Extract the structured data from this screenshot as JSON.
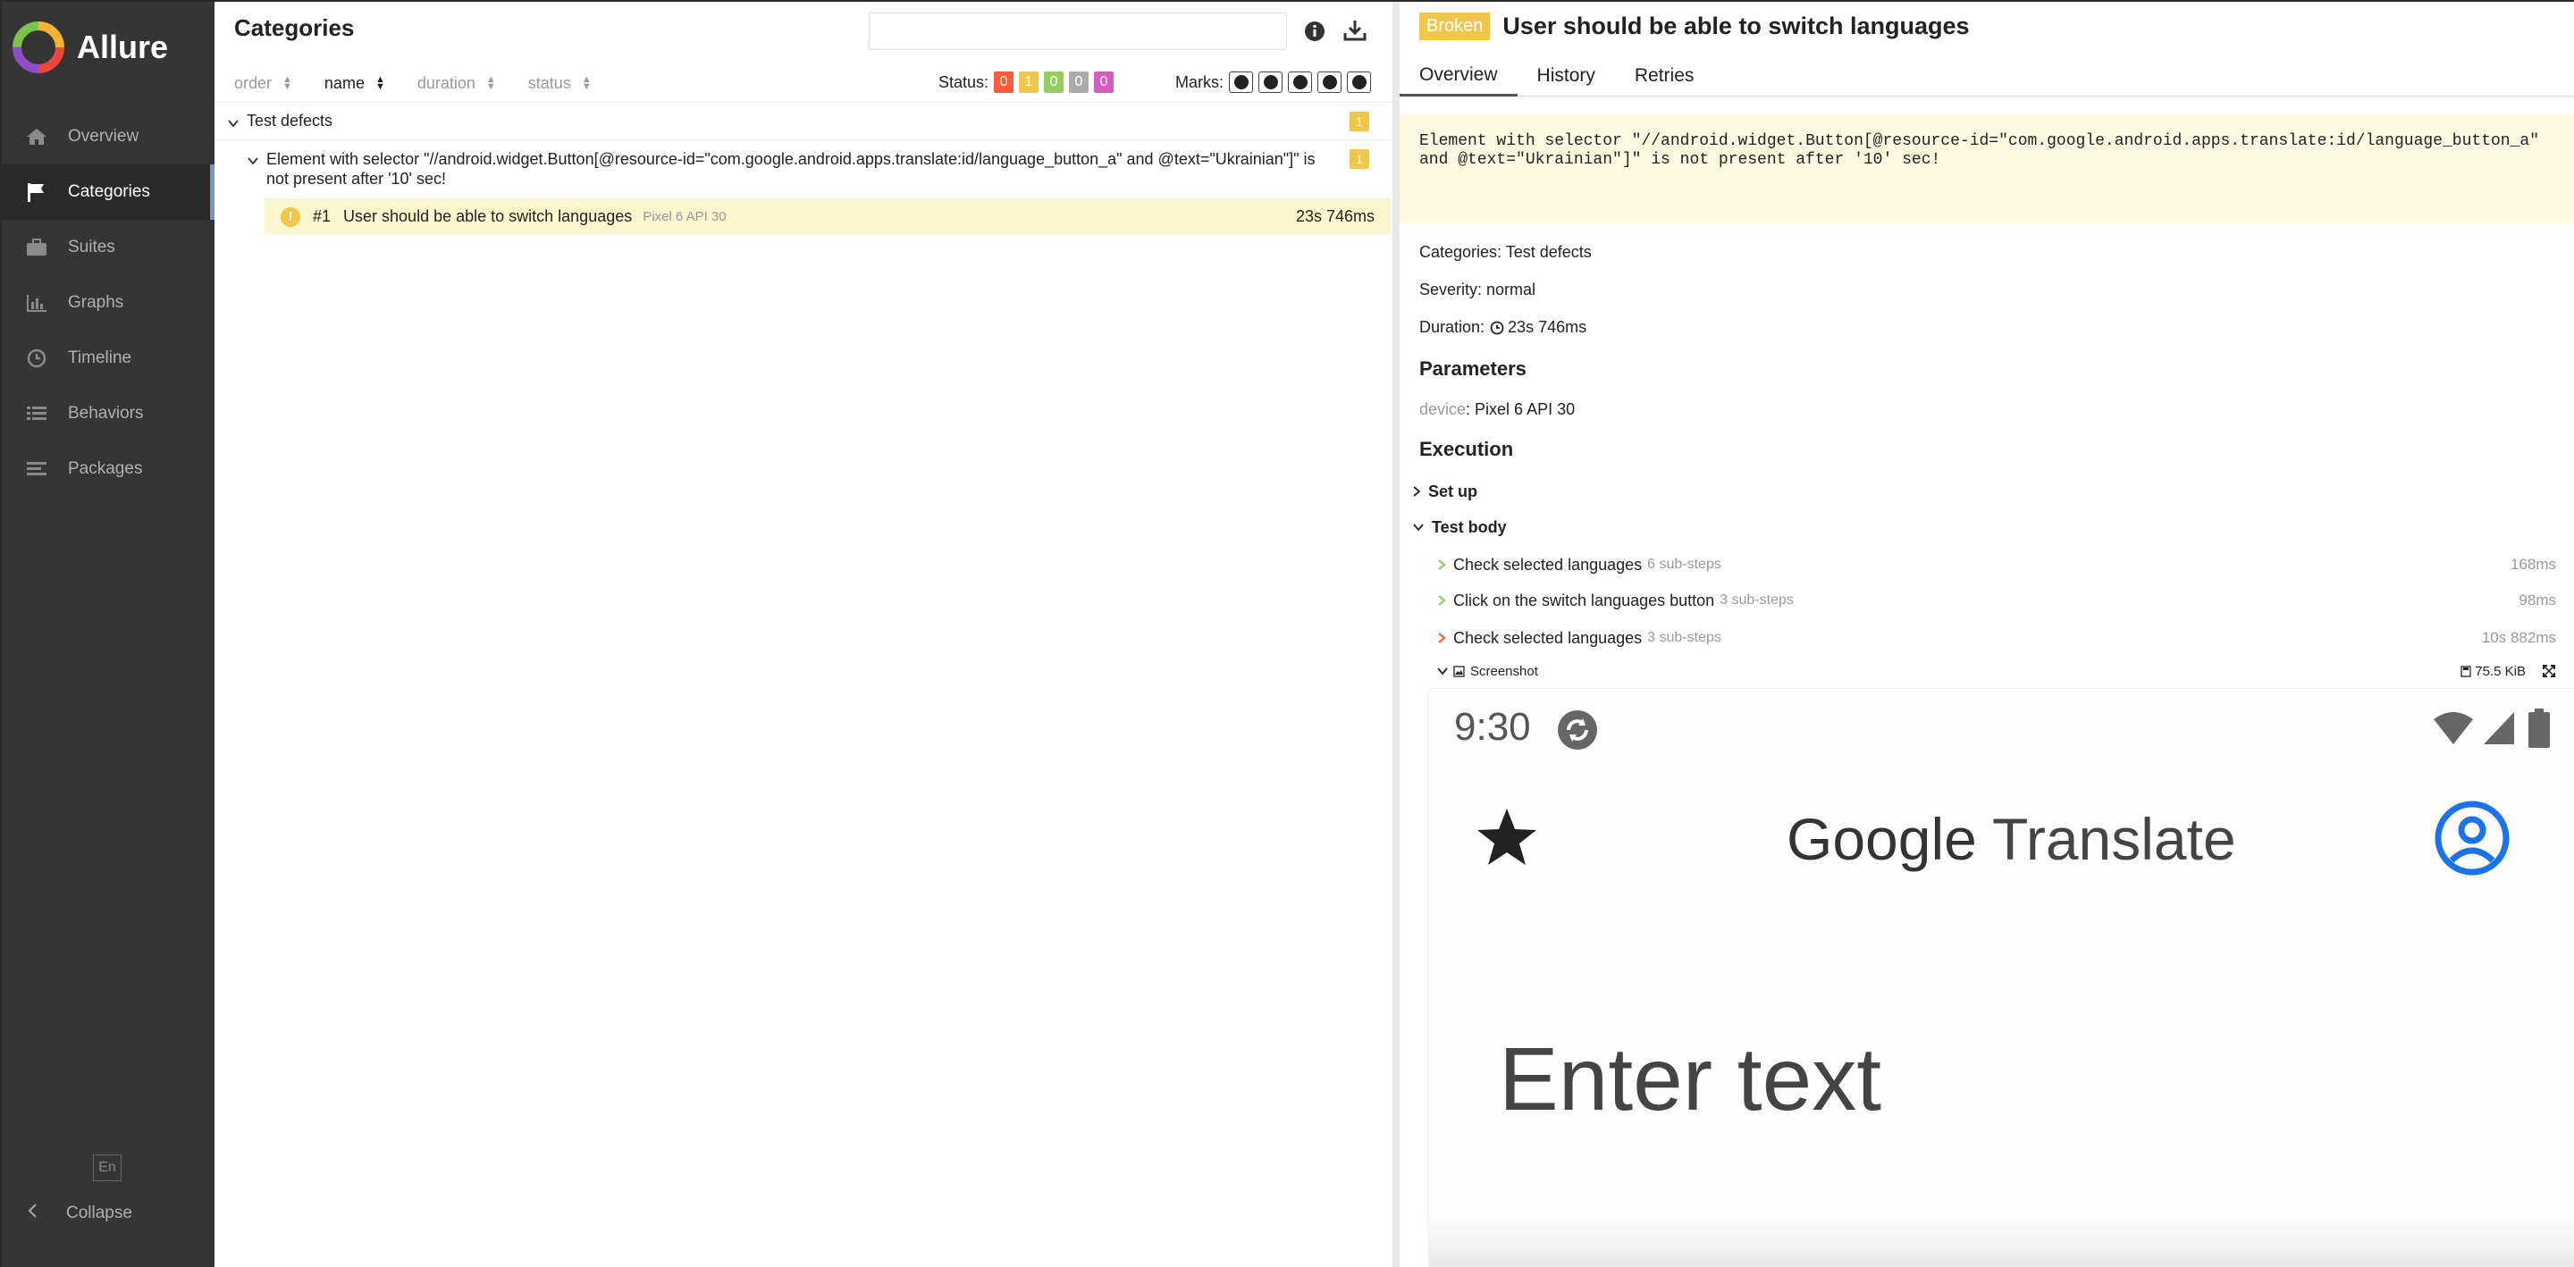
{
  "app": {
    "name": "Allure"
  },
  "sidebar": {
    "items": [
      {
        "label": "Overview",
        "icon": "home-icon",
        "active": false
      },
      {
        "label": "Categories",
        "icon": "flag-icon",
        "active": true
      },
      {
        "label": "Suites",
        "icon": "briefcase-icon",
        "active": false
      },
      {
        "label": "Graphs",
        "icon": "bar-chart-icon",
        "active": false
      },
      {
        "label": "Timeline",
        "icon": "clock-icon",
        "active": false
      },
      {
        "label": "Behaviors",
        "icon": "list-icon",
        "active": false
      },
      {
        "label": "Packages",
        "icon": "align-left-icon",
        "active": false
      }
    ],
    "language": "En",
    "collapse_label": "Collapse"
  },
  "left": {
    "title": "Categories",
    "search": {
      "value": "",
      "placeholder": ""
    },
    "sort": {
      "order": "order",
      "name": "name",
      "duration": "duration",
      "status": "status"
    },
    "status_label": "Status:",
    "status_counts": [
      {
        "value": "0",
        "color": "#fd5a3e"
      },
      {
        "value": "1",
        "color": "#f0c74b"
      },
      {
        "value": "0",
        "color": "#97cc64"
      },
      {
        "value": "0",
        "color": "#aaaaaa"
      },
      {
        "value": "0",
        "color": "#d35ebe"
      }
    ],
    "marks_label": "Marks:",
    "tree": {
      "category": "Test defects",
      "category_count": "1",
      "message": "Element with selector \"//android.widget.Button[@resource-id=\"com.google.android.apps.translate:id/language_button_a\" and @text=\"Ukrainian\"]\" is not present after '10' sec!",
      "message_count": "1",
      "test": {
        "number": "#1",
        "name": "User should be able to switch languages",
        "param": "Pixel 6 API 30",
        "duration": "23s 746ms"
      }
    }
  },
  "right": {
    "status_badge": "Broken",
    "title": "User should be able to switch languages",
    "tabs": [
      "Overview",
      "History",
      "Retries"
    ],
    "error": "Element with selector \"//android.widget.Button[@resource-id=\"com.google.android.apps.translate:id/language_button_a\" and @text=\"Ukrainian\"]\" is not present after '10' sec!",
    "categories_line": "Categories: Test defects",
    "severity_line": "Severity: normal",
    "duration_label": "Duration:",
    "duration_value": "23s 746ms",
    "parameters_title": "Parameters",
    "param_key": "device",
    "param_value": ": Pixel 6 API 30",
    "execution_title": "Execution",
    "setup_label": "Set up",
    "body_label": "Test body",
    "steps": [
      {
        "name": "Check selected languages",
        "sub": "6 sub-steps",
        "duration": "168ms",
        "status": "passed"
      },
      {
        "name": "Click on the switch languages button",
        "sub": "3 sub-steps",
        "duration": "98ms",
        "status": "passed"
      },
      {
        "name": "Check selected languages",
        "sub": "3 sub-steps",
        "duration": "10s 882ms",
        "status": "failed"
      }
    ],
    "attachment": {
      "name": "Screenshot",
      "size": "75.5 KiB"
    },
    "phone": {
      "time": "9:30",
      "logo_google": "Google",
      "logo_translate": "Translate",
      "input_placeholder": "Enter text"
    }
  }
}
